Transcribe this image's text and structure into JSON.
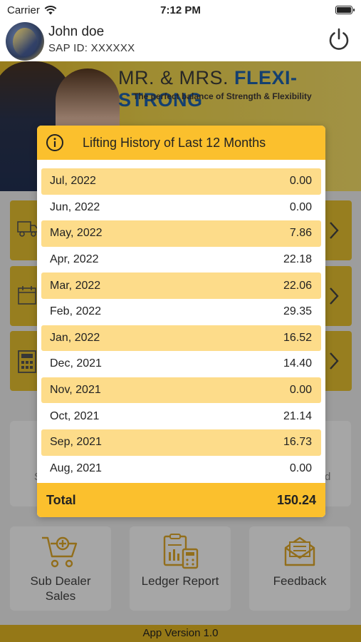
{
  "status_bar": {
    "carrier": "Carrier",
    "time": "7:12 PM"
  },
  "header": {
    "user_name": "John doe",
    "sap_id": "SAP ID: XXXXXX"
  },
  "banner": {
    "brand_prefix": "MR. & MRS.",
    "brand_name": "FLEXI-STRONG",
    "tagline": "The perfect balance of Strength & Flexibility"
  },
  "background_menu": {
    "partial_left_text": "S",
    "partial_right_text": "d",
    "bottom_cards": [
      {
        "label_line1": "Sub Dealer",
        "label_line2": "Sales"
      },
      {
        "label_line1": "Ledger Report",
        "label_line2": ""
      },
      {
        "label_line1": "Feedback",
        "label_line2": ""
      }
    ]
  },
  "footer": {
    "version": "App Version 1.0"
  },
  "modal": {
    "title": "Lifting History of Last 12 Months",
    "rows": [
      {
        "month": "Jul, 2022",
        "value": "0.00"
      },
      {
        "month": "Jun, 2022",
        "value": "0.00"
      },
      {
        "month": "May, 2022",
        "value": "7.86"
      },
      {
        "month": "Apr, 2022",
        "value": "22.18"
      },
      {
        "month": "Mar, 2022",
        "value": "22.06"
      },
      {
        "month": "Feb, 2022",
        "value": "29.35"
      },
      {
        "month": "Jan, 2022",
        "value": "16.52"
      },
      {
        "month": "Dec, 2021",
        "value": "14.40"
      },
      {
        "month": "Nov, 2021",
        "value": "0.00"
      },
      {
        "month": "Oct, 2021",
        "value": "21.14"
      },
      {
        "month": "Sep, 2021",
        "value": "16.73"
      },
      {
        "month": "Aug, 2021",
        "value": "0.00"
      }
    ],
    "total_label": "Total",
    "total_value": "150.24"
  },
  "colors": {
    "accent": "#fbc02d",
    "row_highlight": "#fddc8a",
    "brand_blue": "#1f63ad"
  }
}
